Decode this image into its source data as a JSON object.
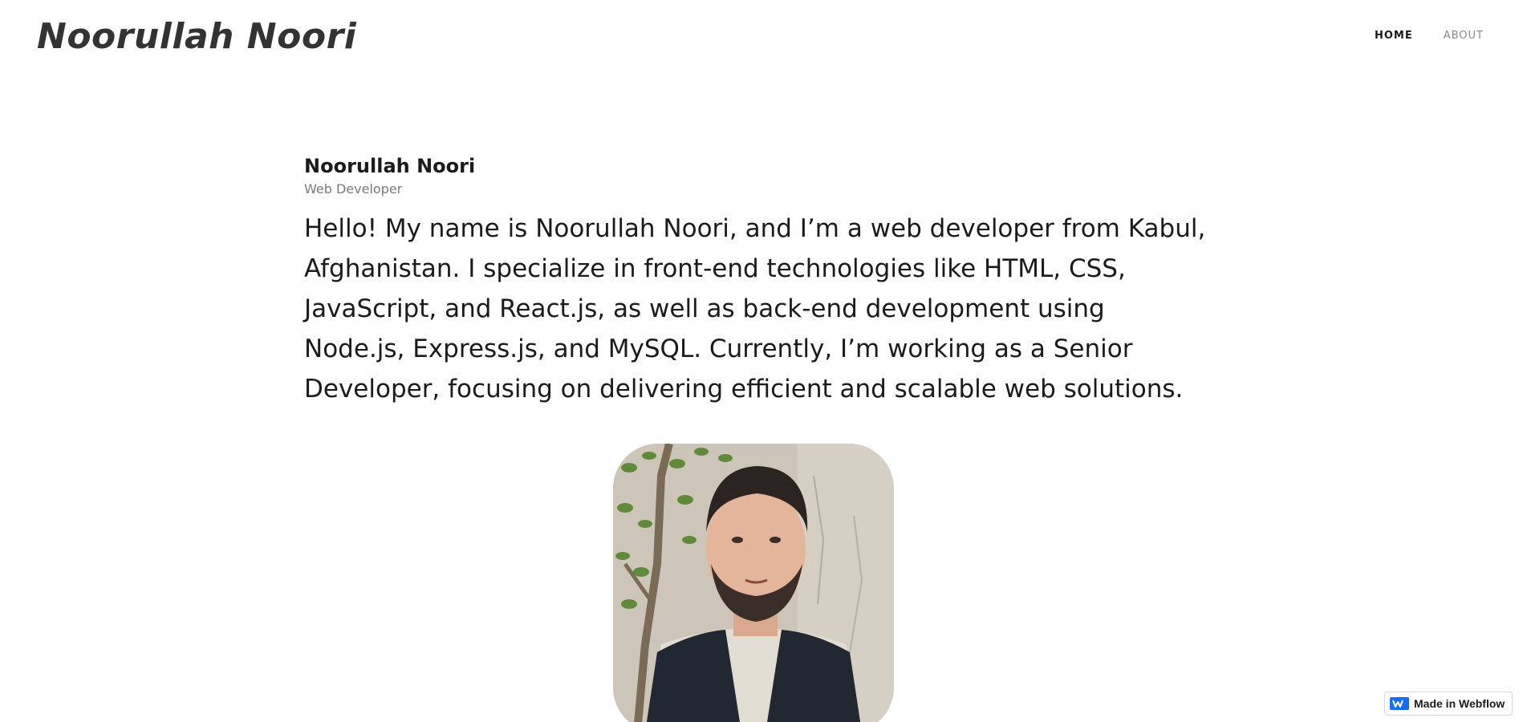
{
  "header": {
    "logo_text": "Noorullah Noori",
    "nav": [
      {
        "label": "HOME",
        "active": true
      },
      {
        "label": "ABOUT",
        "active": false
      }
    ]
  },
  "profile": {
    "name": "Noorullah Noori",
    "role": "Web Developer",
    "bio": "Hello! My name is Noorullah Noori, and I’m a web developer from Kabul, Afghanistan. I specialize in front-end technologies like HTML, CSS, JavaScript, and React.js, as well as back-end development using Node.js, Express.js, and MySQL. Currently, I’m working as a Senior Developer, focusing on delivering efficient and scalable web solutions."
  },
  "badge": {
    "label": "Made in Webflow",
    "icon": "webflow-logo-icon",
    "brand_color": "#146ef5"
  },
  "colors": {
    "text": "#1a1b1f",
    "muted": "#7a7a80",
    "logo": "#333333",
    "background": "#ffffff"
  }
}
